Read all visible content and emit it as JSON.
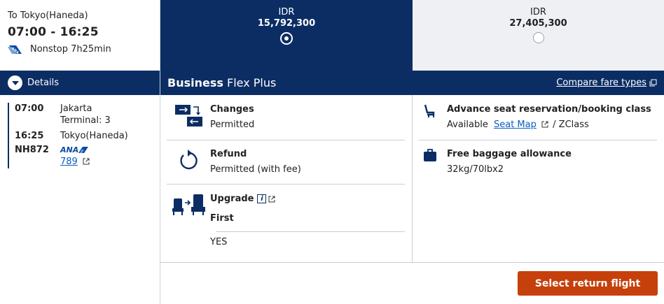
{
  "flight": {
    "destination": "To Tokyo(Haneda)",
    "times": "07:00 - 16:25",
    "nonstop": "Nonstop 7h25min",
    "airline_badge": "ANA"
  },
  "details": {
    "label": "Details",
    "depart_time": "07:00",
    "depart_city": "Jakarta",
    "depart_terminal": "Terminal: 3",
    "arrive_time": "16:25",
    "arrive_city": "Tokyo(Haneda)",
    "flight_no": "NH872",
    "airline_logo": "ANA",
    "aircraft": "789"
  },
  "fares": [
    {
      "currency": "IDR",
      "price": "15,792,300",
      "selected": true
    },
    {
      "currency": "IDR",
      "price": "27,405,300",
      "selected": false
    }
  ],
  "fare_bar": {
    "name_bold": "Business",
    "name_rest": "Flex Plus",
    "compare_label": "Compare fare types"
  },
  "features": {
    "changes": {
      "title": "Changes",
      "value": "Permitted"
    },
    "refund": {
      "title": "Refund",
      "value": "Permitted (with fee)"
    },
    "upgrade": {
      "title": "Upgrade",
      "class": "First",
      "value": "YES"
    },
    "seat": {
      "title": "Advance seat reservation/booking class",
      "available": "Available",
      "seat_map": "Seat Map",
      "class_suffix": "/ ZClass"
    },
    "baggage": {
      "title": "Free baggage allowance",
      "value": "32kg/70lbx2"
    }
  },
  "select_button": "Select return flight",
  "colors": {
    "navy": "#0b2d64",
    "orange": "#c6400b",
    "link": "#0a5cc4",
    "grey_bg": "#eef0f4"
  }
}
